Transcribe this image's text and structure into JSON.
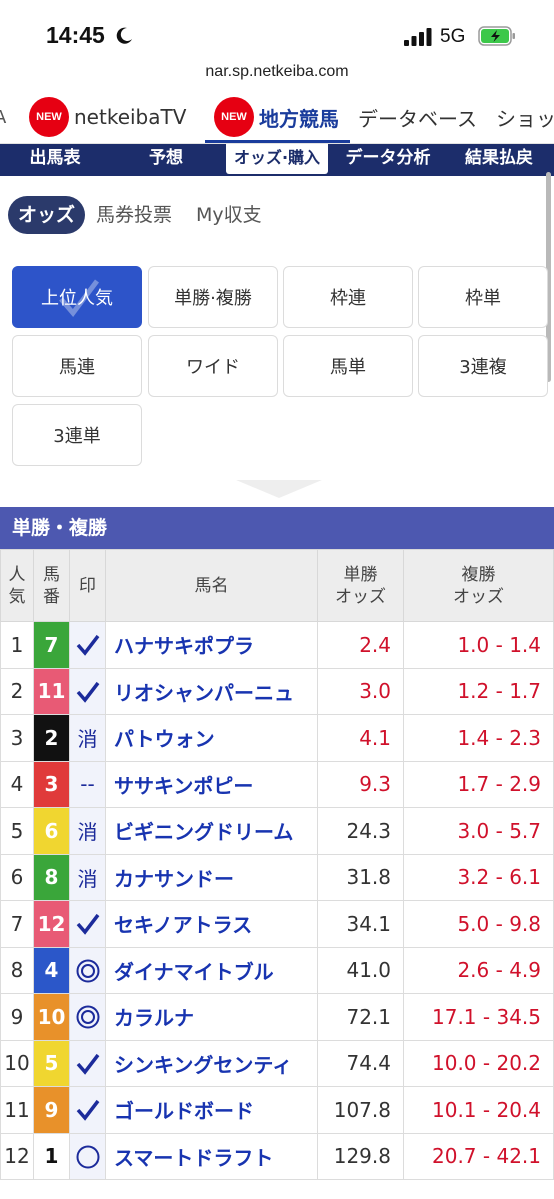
{
  "status": {
    "time": "14:45",
    "network": "5G"
  },
  "url": "nar.sp.netkeiba.com",
  "topnav": {
    "edge": "A",
    "items": [
      {
        "badge": "NEW",
        "label": "netkeibaTV"
      },
      {
        "badge": "NEW",
        "label": "地方競馬"
      },
      {
        "label": "データベース"
      },
      {
        "label": "ショッ"
      }
    ]
  },
  "race_tabs": [
    "出馬表",
    "予想",
    "オッズ·購入",
    "データ分析",
    "結果払戻"
  ],
  "sub_tabs": [
    "オッズ",
    "馬券投票",
    "My収支"
  ],
  "bet_types": [
    "上位人気",
    "単勝·複勝",
    "枠連",
    "枠単",
    "馬連",
    "ワイド",
    "馬単",
    "3連複",
    "3連単"
  ],
  "section_title": "単勝・複勝",
  "table": {
    "headers": {
      "rank": [
        "人",
        "気"
      ],
      "num": [
        "馬",
        "番"
      ],
      "mark": "印",
      "name": "馬名",
      "win": [
        "単勝",
        "オッズ"
      ],
      "place": [
        "複勝",
        "オッズ"
      ]
    },
    "rows": [
      {
        "rank": "1",
        "num": "7",
        "frame_color": "#3aa63a",
        "num_color": "#ffffff",
        "mark": "check",
        "name": "ハナサキポプラ",
        "win": "2.4",
        "place": "1.0 - 1.4",
        "hot": true
      },
      {
        "rank": "2",
        "num": "11",
        "frame_color": "#e85a75",
        "num_color": "#ffffff",
        "mark": "check",
        "name": "リオシャンパーニュ",
        "win": "3.0",
        "place": "1.2 - 1.7",
        "hot": true
      },
      {
        "rank": "3",
        "num": "2",
        "frame_color": "#111111",
        "num_color": "#ffffff",
        "mark": "消",
        "name": "パトウォン",
        "win": "4.1",
        "place": "1.4 - 2.3",
        "hot": true
      },
      {
        "rank": "4",
        "num": "3",
        "frame_color": "#e03a3a",
        "num_color": "#ffffff",
        "mark": "--",
        "name": "ササキンポピー",
        "win": "9.3",
        "place": "1.7 - 2.9",
        "hot": true
      },
      {
        "rank": "5",
        "num": "6",
        "frame_color": "#f0d630",
        "num_color": "#ffffff",
        "mark": "消",
        "name": "ビギニングドリーム",
        "win": "24.3",
        "place": "3.0 - 5.7",
        "hot": false
      },
      {
        "rank": "6",
        "num": "8",
        "frame_color": "#3aa63a",
        "num_color": "#ffffff",
        "mark": "消",
        "name": "カナサンドー",
        "win": "31.8",
        "place": "3.2 - 6.1",
        "hot": false
      },
      {
        "rank": "7",
        "num": "12",
        "frame_color": "#e85a75",
        "num_color": "#ffffff",
        "mark": "check",
        "name": "セキノアトラス",
        "win": "34.1",
        "place": "5.0 - 9.8",
        "hot": false
      },
      {
        "rank": "8",
        "num": "4",
        "frame_color": "#2b57c9",
        "num_color": "#ffffff",
        "mark": "double-circle",
        "name": "ダイナマイトブル",
        "win": "41.0",
        "place": "2.6 - 4.9",
        "hot": false
      },
      {
        "rank": "9",
        "num": "10",
        "frame_color": "#e8912a",
        "num_color": "#ffffff",
        "mark": "double-circle",
        "name": "カラルナ",
        "win": "72.1",
        "place": "17.1 - 34.5",
        "hot": false
      },
      {
        "rank": "10",
        "num": "5",
        "frame_color": "#f0d630",
        "num_color": "#ffffff",
        "mark": "check",
        "name": "シンキングセンティ",
        "win": "74.4",
        "place": "10.0 - 20.2",
        "hot": false
      },
      {
        "rank": "11",
        "num": "9",
        "frame_color": "#e8912a",
        "num_color": "#ffffff",
        "mark": "check",
        "name": "ゴールドボード",
        "win": "107.8",
        "place": "10.1 - 20.4",
        "hot": false
      },
      {
        "rank": "12",
        "num": "1",
        "frame_color": "#ffffff",
        "num_color": "#111111",
        "mark": "circle",
        "name": "スマートドラフト",
        "win": "129.8",
        "place": "20.7 - 42.1",
        "hot": false
      }
    ]
  }
}
